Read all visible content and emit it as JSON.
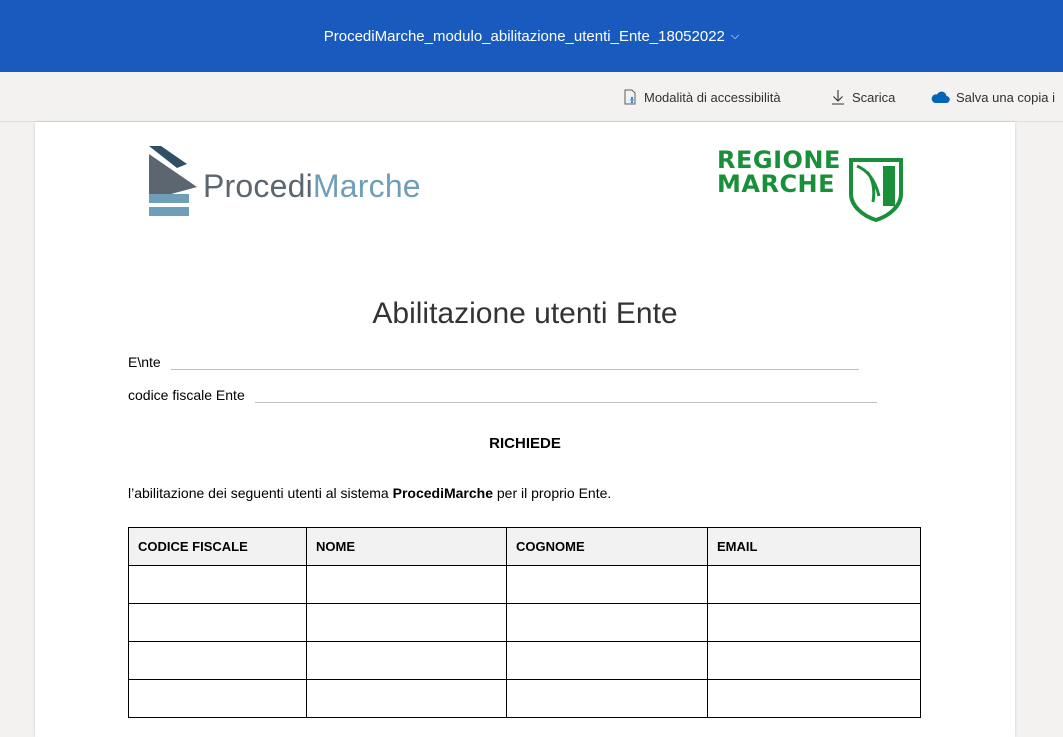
{
  "titlebar": {
    "filename": "ProcediMarche_modulo_abilitazione_utenti_Ente_18052022",
    "chevron": "⌵"
  },
  "toolbar": {
    "accessibility_label": "Modalità di accessibilità",
    "download_label": "Scarica",
    "save_copy_label": "Salva una copia i",
    "icons": [
      "accessibility-icon",
      "download-icon",
      "onedrive-cloud-icon"
    ]
  },
  "document": {
    "logo_left": {
      "part1": "Procedi",
      "part2": "Marche"
    },
    "logo_right": {
      "line1": "REGIONE",
      "line2": "MARCHE"
    },
    "title": "Abilitazione utenti Ente",
    "field_ente": "E\\nte",
    "field_cf": "codice fiscale Ente",
    "richiede": "RICHIEDE",
    "intro": {
      "before": "l’abilitazione dei seguenti utenti al sistema ",
      "bold": "ProcediMarche",
      "after": " per il proprio Ente."
    },
    "table": {
      "headers": [
        "CODICE FISCALE",
        "NOME",
        "COGNOME",
        "EMAIL"
      ],
      "rows": [
        [
          "",
          "",
          "",
          ""
        ],
        [
          "",
          "",
          "",
          ""
        ],
        [
          "",
          "",
          "",
          ""
        ],
        [
          "",
          "",
          "",
          ""
        ]
      ]
    }
  },
  "colors": {
    "titlebar": "#185abd",
    "regione_green": "#1a8f3a",
    "logo_blue": "#6f9fb8",
    "logo_grey": "#5c6670"
  }
}
